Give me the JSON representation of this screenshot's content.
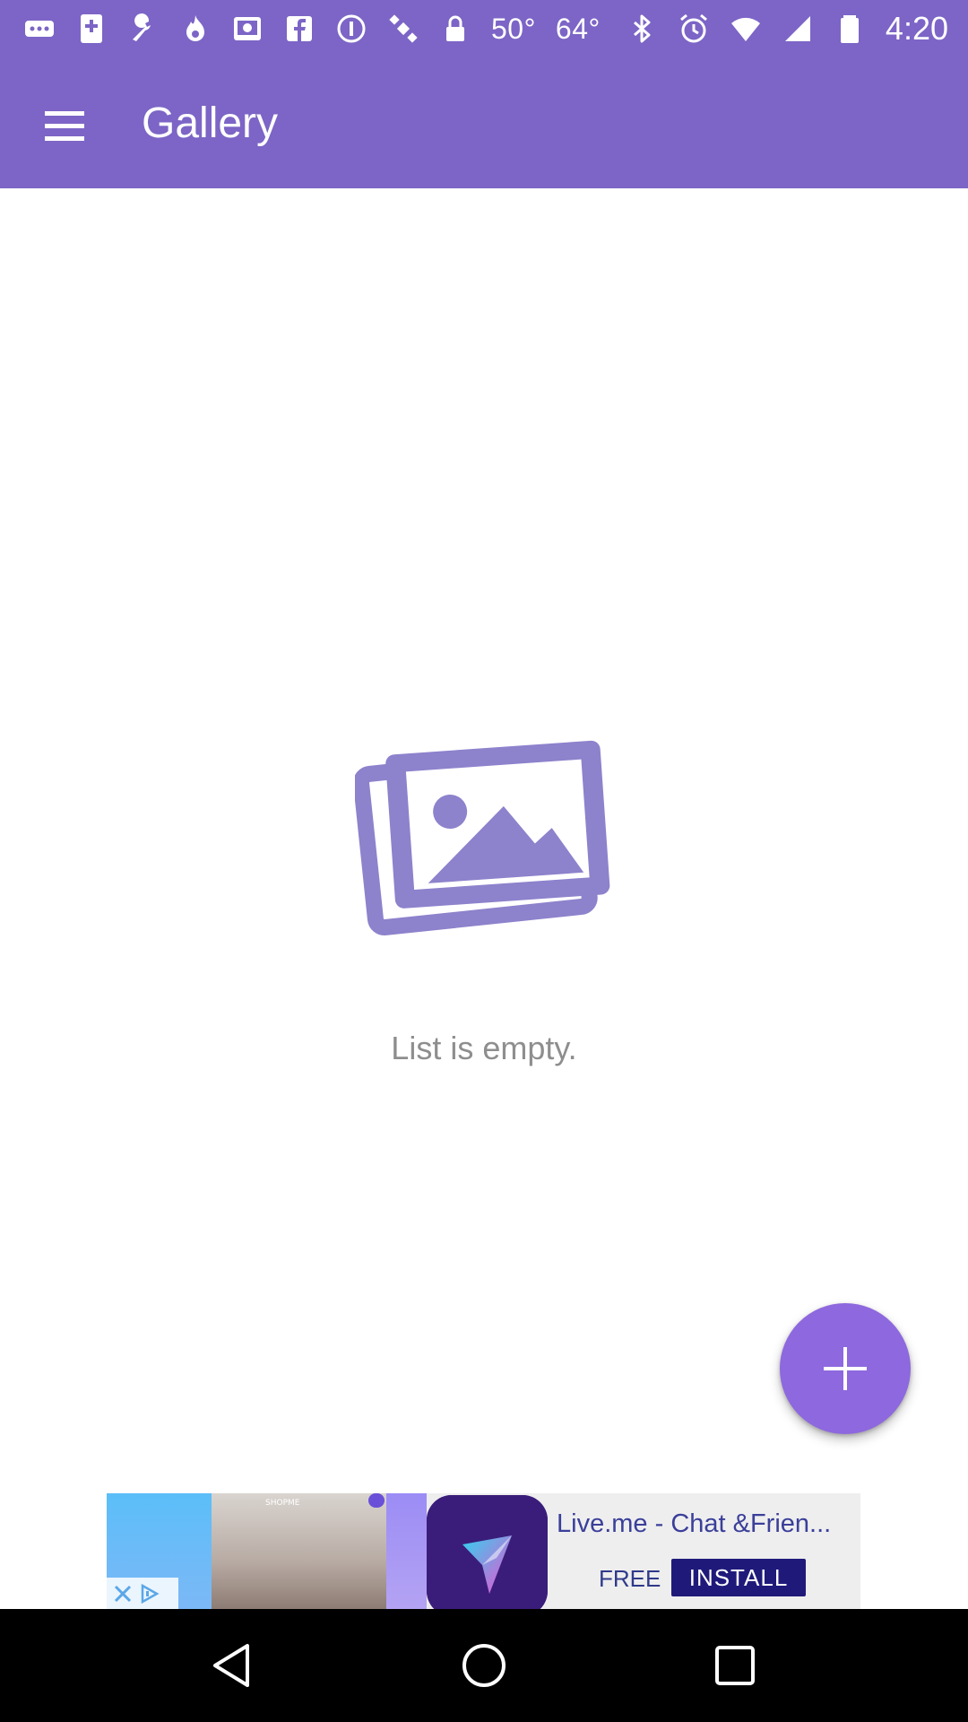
{
  "status_bar": {
    "left_icons": [
      "more-icon",
      "plus-icon",
      "wrench-icon",
      "flame-icon",
      "photo-icon",
      "facebook-icon",
      "info-icon",
      "satellite-icon",
      "lock-icon"
    ],
    "temp_1": "50°",
    "temp_2": "64°",
    "right_icons": [
      "bluetooth-icon",
      "alarm-icon",
      "wifi-icon",
      "signal-icon",
      "battery-icon"
    ],
    "time": "4:20"
  },
  "app_bar": {
    "title": "Gallery"
  },
  "empty_state": {
    "message": "List is empty."
  },
  "ad": {
    "photo_label": "SHOPME",
    "title": "Live.me - Chat &Frien...",
    "free_label": "FREE",
    "install_label": "INSTALL"
  },
  "colors": {
    "primary": "#7c65c6",
    "fab": "#8e68de",
    "illustration": "#8d82cc"
  }
}
